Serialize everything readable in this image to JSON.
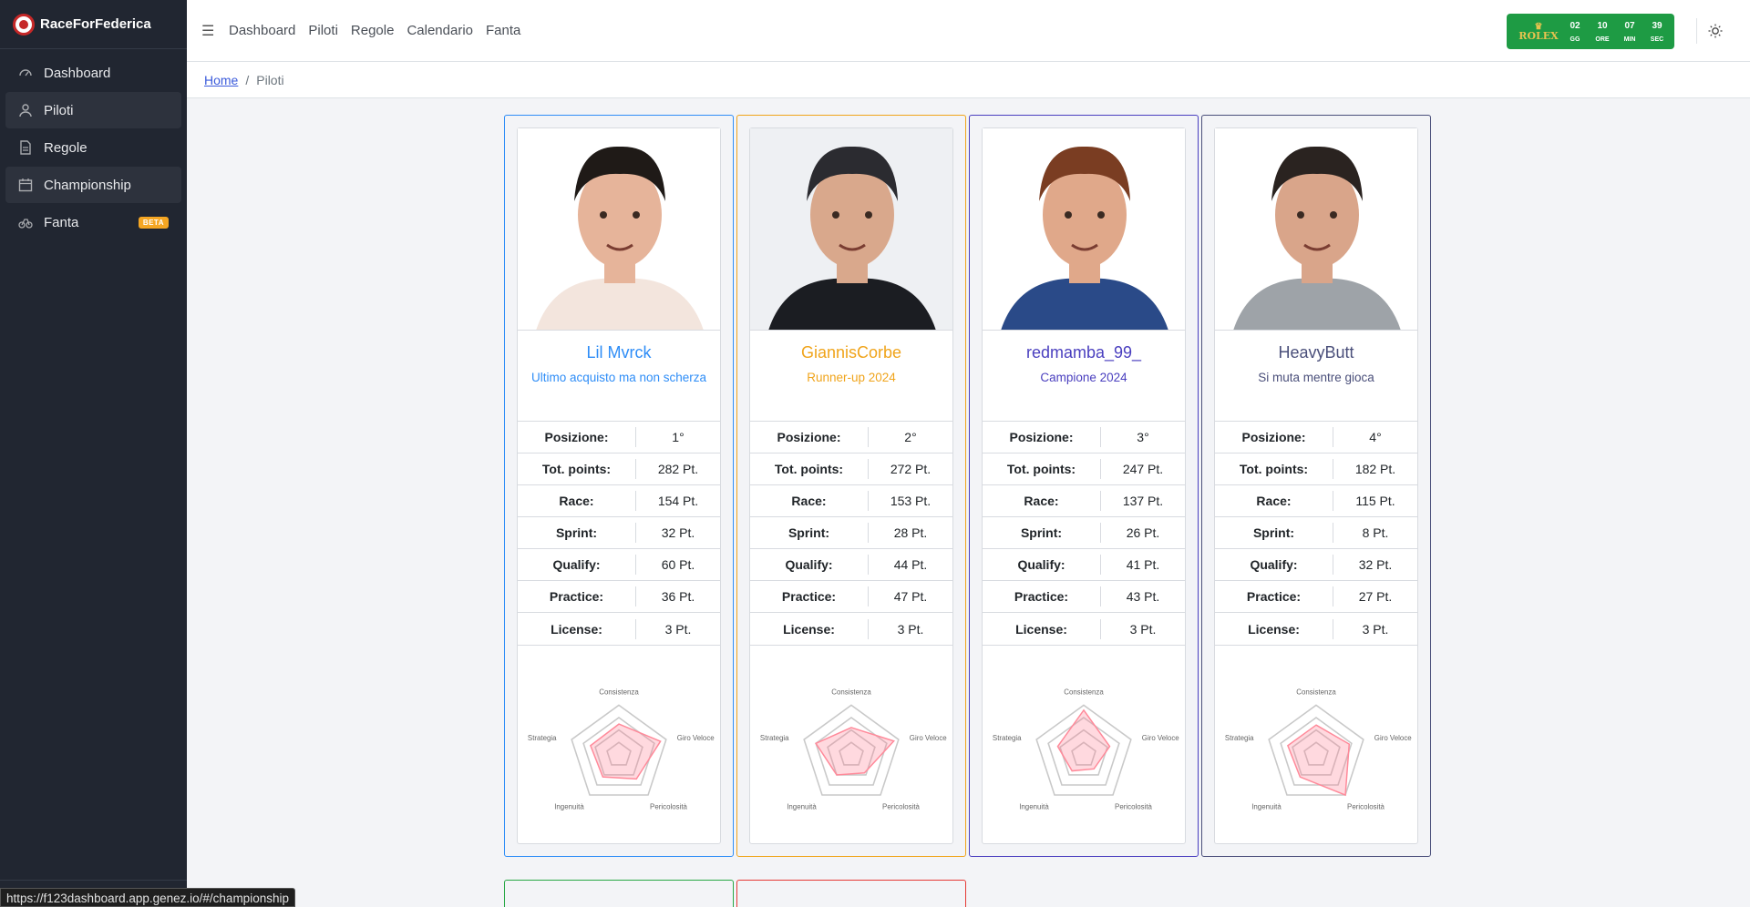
{
  "app": {
    "name": "RaceForFederica"
  },
  "sidebar": {
    "items": [
      {
        "label": "Dashboard",
        "icon": "speedometer-icon"
      },
      {
        "label": "Piloti",
        "icon": "user-icon"
      },
      {
        "label": "Regole",
        "icon": "document-icon"
      },
      {
        "label": "Championship",
        "icon": "calendar-icon"
      },
      {
        "label": "Fanta",
        "icon": "bike-icon",
        "badge": "BETA"
      }
    ]
  },
  "topnav": [
    "Dashboard",
    "Piloti",
    "Regole",
    "Calendario",
    "Fanta"
  ],
  "timer": {
    "brand": "ROLEX",
    "units": [
      {
        "value": "02",
        "label": "GG"
      },
      {
        "value": "10",
        "label": "ORE"
      },
      {
        "value": "07",
        "label": "MIN"
      },
      {
        "value": "39",
        "label": "SEC"
      }
    ]
  },
  "breadcrumb": {
    "home": "Home",
    "current": "Piloti"
  },
  "stat_labels": [
    "Posizione:",
    "Tot. points:",
    "Race:",
    "Sprint:",
    "Qualify:",
    "Practice:",
    "License:"
  ],
  "radar_labels": [
    "Consistenza",
    "Giro Veloce",
    "Pericolosità",
    "Ingenuità",
    "Strategia"
  ],
  "drivers": [
    {
      "name": "Lil Mvrck",
      "subtitle": "Ultimo acquisto ma non scherza",
      "color": "#2e8df7",
      "stats": [
        "1°",
        "282 Pt.",
        "154 Pt.",
        "32 Pt.",
        "60 Pt.",
        "36 Pt.",
        "3 Pt."
      ],
      "radar": [
        0.62,
        0.88,
        0.6,
        0.55,
        0.6
      ]
    },
    {
      "name": "GiannisCorbe",
      "subtitle": "Runner-up 2024",
      "color": "#f0a41b",
      "stats": [
        "2°",
        "272 Pt.",
        "153 Pt.",
        "28 Pt.",
        "44 Pt.",
        "47 Pt.",
        "3 Pt."
      ],
      "radar": [
        0.55,
        0.9,
        0.45,
        0.5,
        0.75
      ]
    },
    {
      "name": "redmamba_99_",
      "subtitle": "Campione 2024",
      "color": "#4a3fbf",
      "stats": [
        "3°",
        "247 Pt.",
        "137 Pt.",
        "26 Pt.",
        "41 Pt.",
        "43 Pt.",
        "3 Pt.",
        "3 Pt."
      ],
      "radar": [
        0.9,
        0.55,
        0.35,
        0.4,
        0.55
      ]
    },
    {
      "name": "HeavyButt",
      "subtitle": "Si muta mentre gioca",
      "color": "#4a4f7a",
      "stats": [
        "4°",
        "182 Pt.",
        "115 Pt.",
        "8 Pt.",
        "32 Pt.",
        "27 Pt.",
        "3 Pt."
      ],
      "radar": [
        0.6,
        0.7,
        1.0,
        0.55,
        0.6
      ]
    }
  ],
  "next_row_colors": [
    "#28a745",
    "#e53935"
  ],
  "status_url": "https://f123dashboard.app.genez.io/#/championship"
}
